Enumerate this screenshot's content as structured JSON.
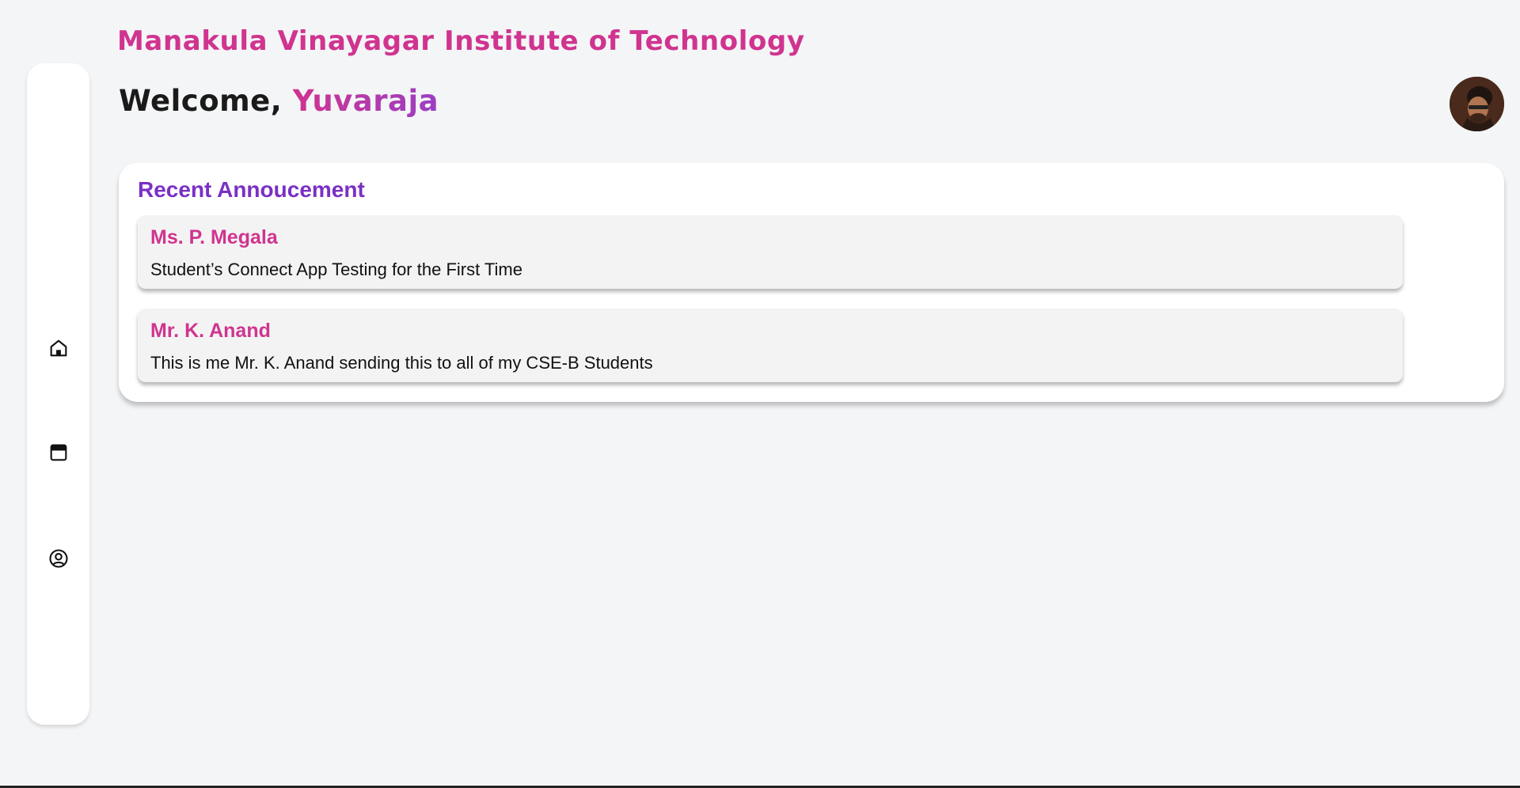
{
  "header": {
    "institute": "Manakula Vinayagar Institute of Technology",
    "welcome_prefix": "Welcome, ",
    "user_name": "Yuvaraja"
  },
  "sidebar": {
    "items": [
      {
        "name": "home",
        "icon": "home-icon"
      },
      {
        "name": "calendar",
        "icon": "calendar-icon"
      },
      {
        "name": "profile",
        "icon": "user-circle-icon"
      }
    ]
  },
  "announcements": {
    "title": "Recent Annoucement",
    "items": [
      {
        "author": "Ms. P. Megala",
        "message": "Student’s Connect App Testing for the First Time"
      },
      {
        "author": "Mr. K. Anand",
        "message": "This is me Mr. K. Anand sending this to all of my CSE-B Students"
      }
    ]
  },
  "colors": {
    "accent_pink": "#d0348f",
    "accent_purple": "#7a30c4",
    "background": "#f4f5f7"
  }
}
